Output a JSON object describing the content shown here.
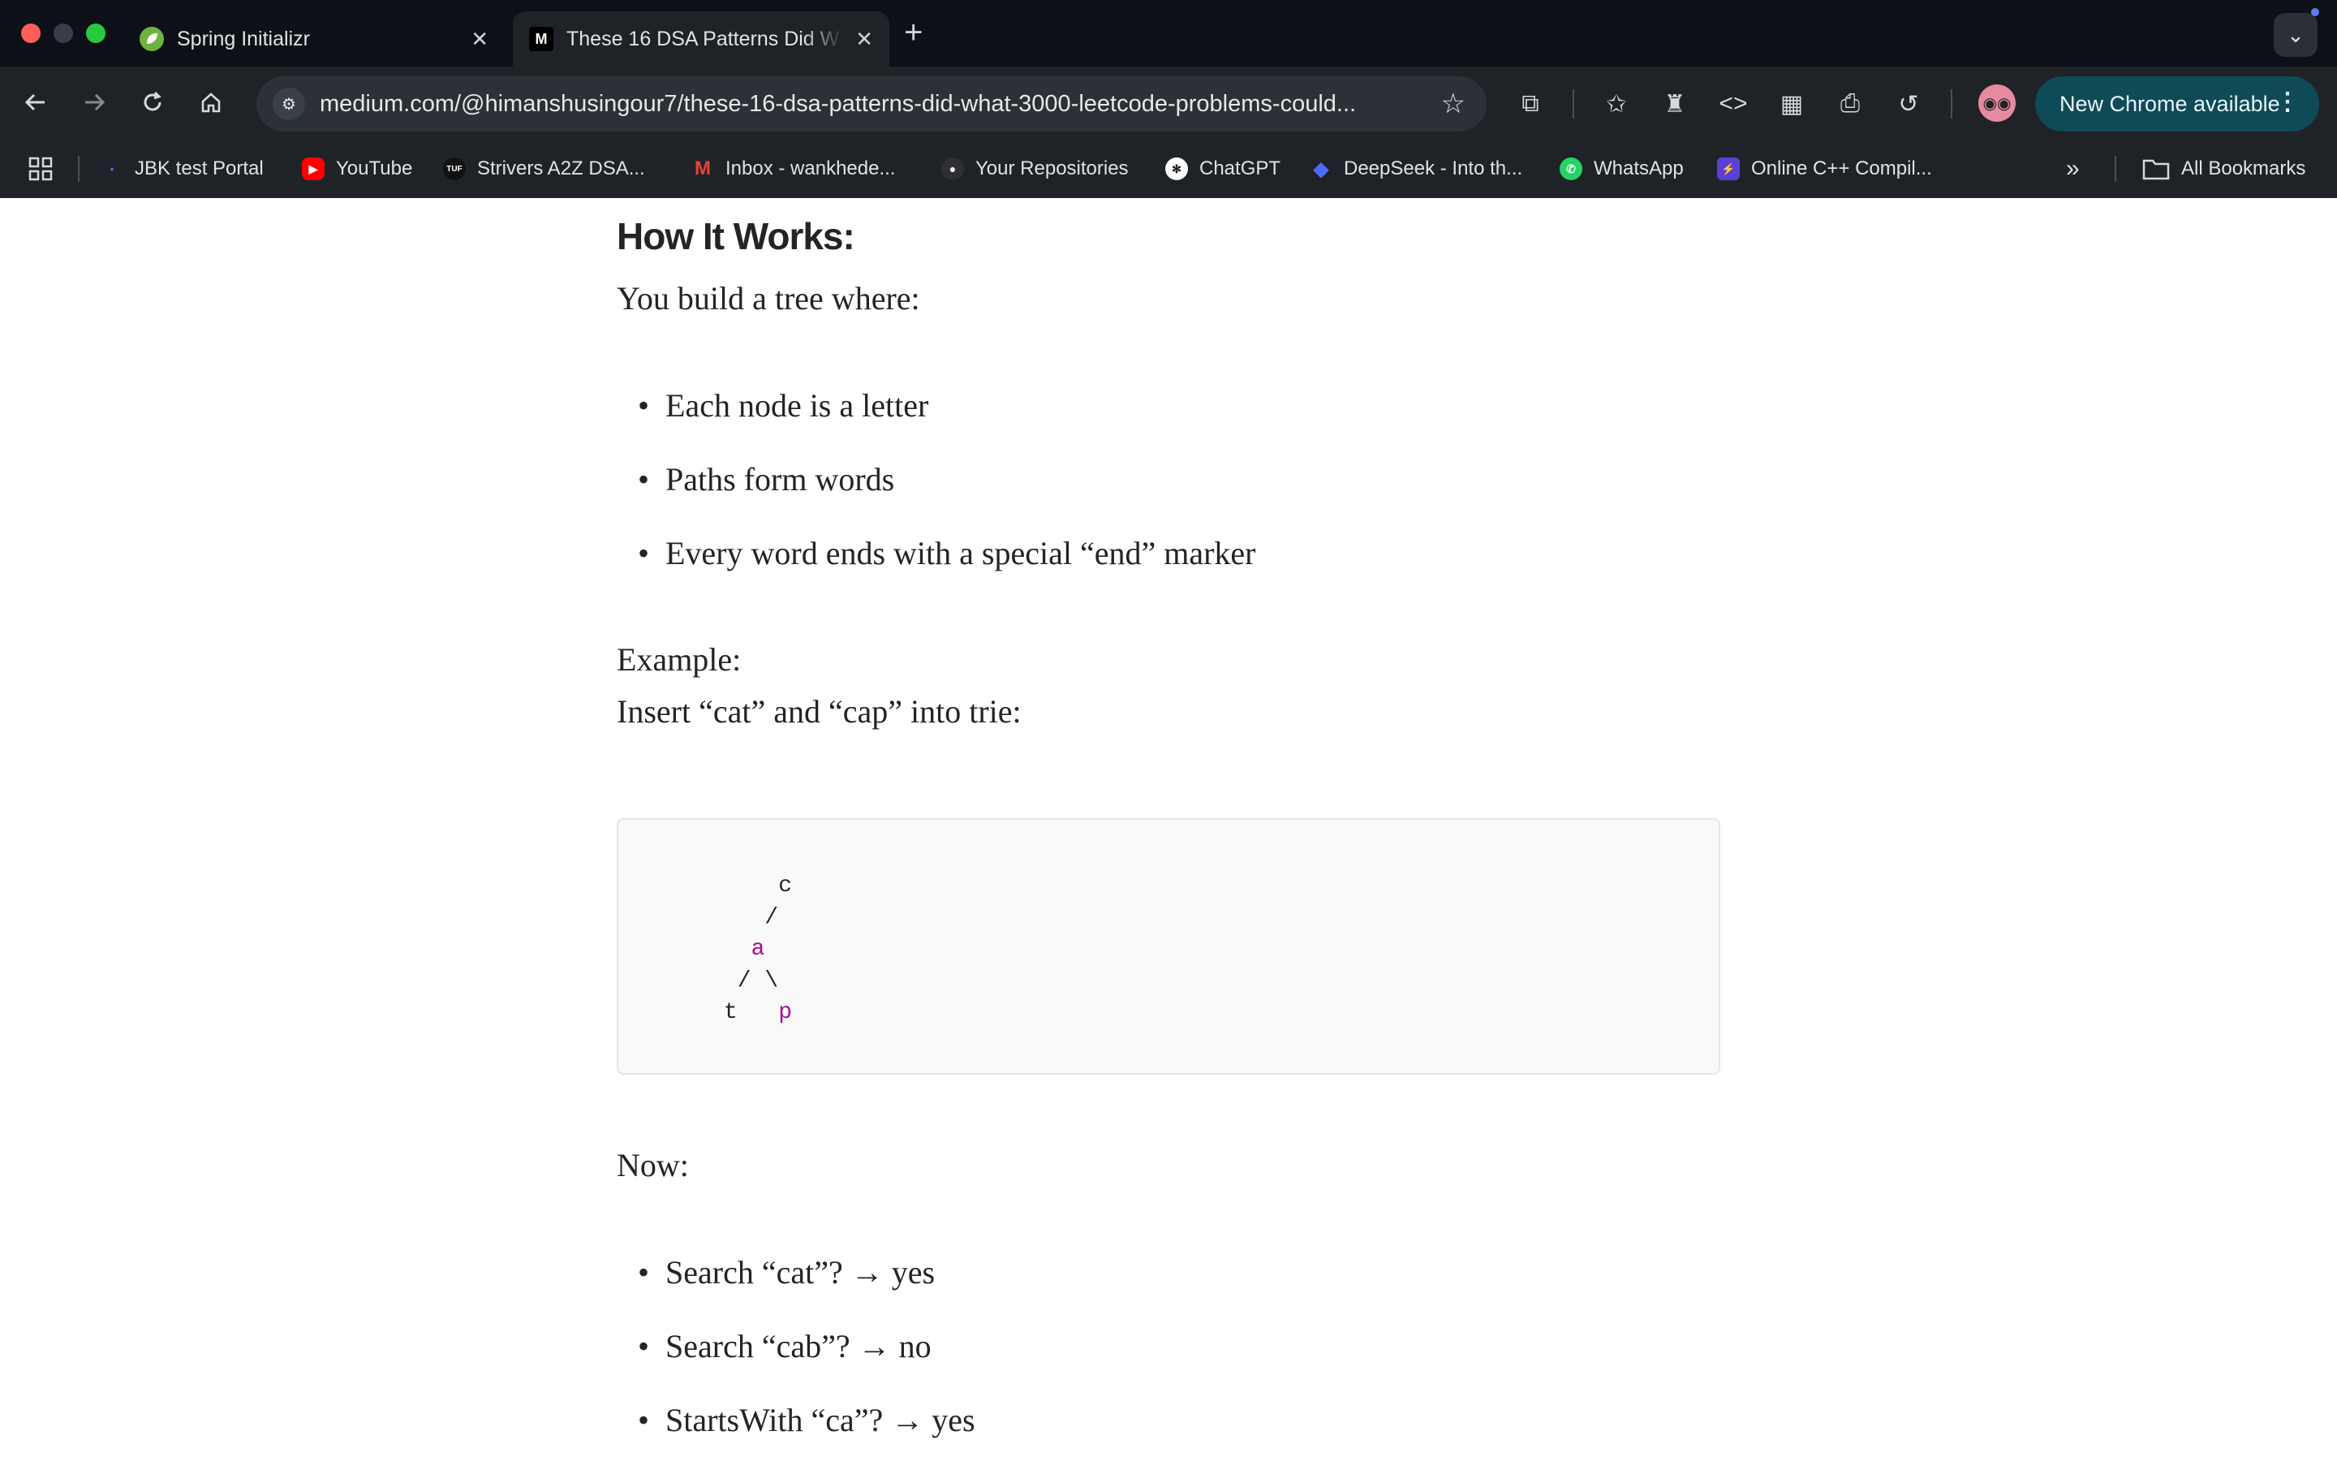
{
  "browser": {
    "tabs": [
      {
        "title": "Spring Initializr",
        "favicon": "spring-leaf-icon",
        "active": false
      },
      {
        "title": "These 16 DSA Patterns Did W",
        "favicon": "medium-logo-icon",
        "favicon_text": "M",
        "active": true
      }
    ],
    "new_tab_label": "+",
    "url": "medium.com/@himanshusingour7/these-16-dsa-patterns-did-what-3000-leetcode-problems-could...",
    "update_button_label": "New Chrome available",
    "bookmarks": [
      {
        "label": "JBK test Portal",
        "icon": "jbk-icon"
      },
      {
        "label": "YouTube",
        "icon": "youtube-icon"
      },
      {
        "label": "Strivers A2Z DSA...",
        "icon": "tuf-icon",
        "icon_text": "TUF"
      },
      {
        "label": "Inbox - wankhede...",
        "icon": "gmail-icon",
        "icon_text": "M"
      },
      {
        "label": "Your Repositories",
        "icon": "github-icon"
      },
      {
        "label": "ChatGPT",
        "icon": "chatgpt-icon"
      },
      {
        "label": "DeepSeek - Into th...",
        "icon": "deepseek-icon"
      },
      {
        "label": "WhatsApp",
        "icon": "whatsapp-icon"
      },
      {
        "label": "Online C++ Compil...",
        "icon": "compiler-icon"
      }
    ],
    "all_bookmarks_label": "All Bookmarks",
    "colors": {
      "accent_update": "#0f4a57",
      "tabstrip": "#0d1117",
      "toolbar": "#1f2328"
    }
  },
  "article": {
    "heading": "How It Works:",
    "intro": "You build a tree where:",
    "bullets_1": [
      "Each node is a letter",
      "Paths form words",
      "Every word ends with a special “end” marker"
    ],
    "example_label": "Example:",
    "example_text": "Insert “cat” and “cap” into trie:",
    "code_lines": [
      "    c",
      "   /",
      "  a",
      " / \\",
      "t   p"
    ],
    "now_label": "Now:",
    "bullets_2": [
      "Search “cat”? → yes",
      "Search “cab”? → no",
      "StartsWith “ca”? → yes"
    ]
  }
}
